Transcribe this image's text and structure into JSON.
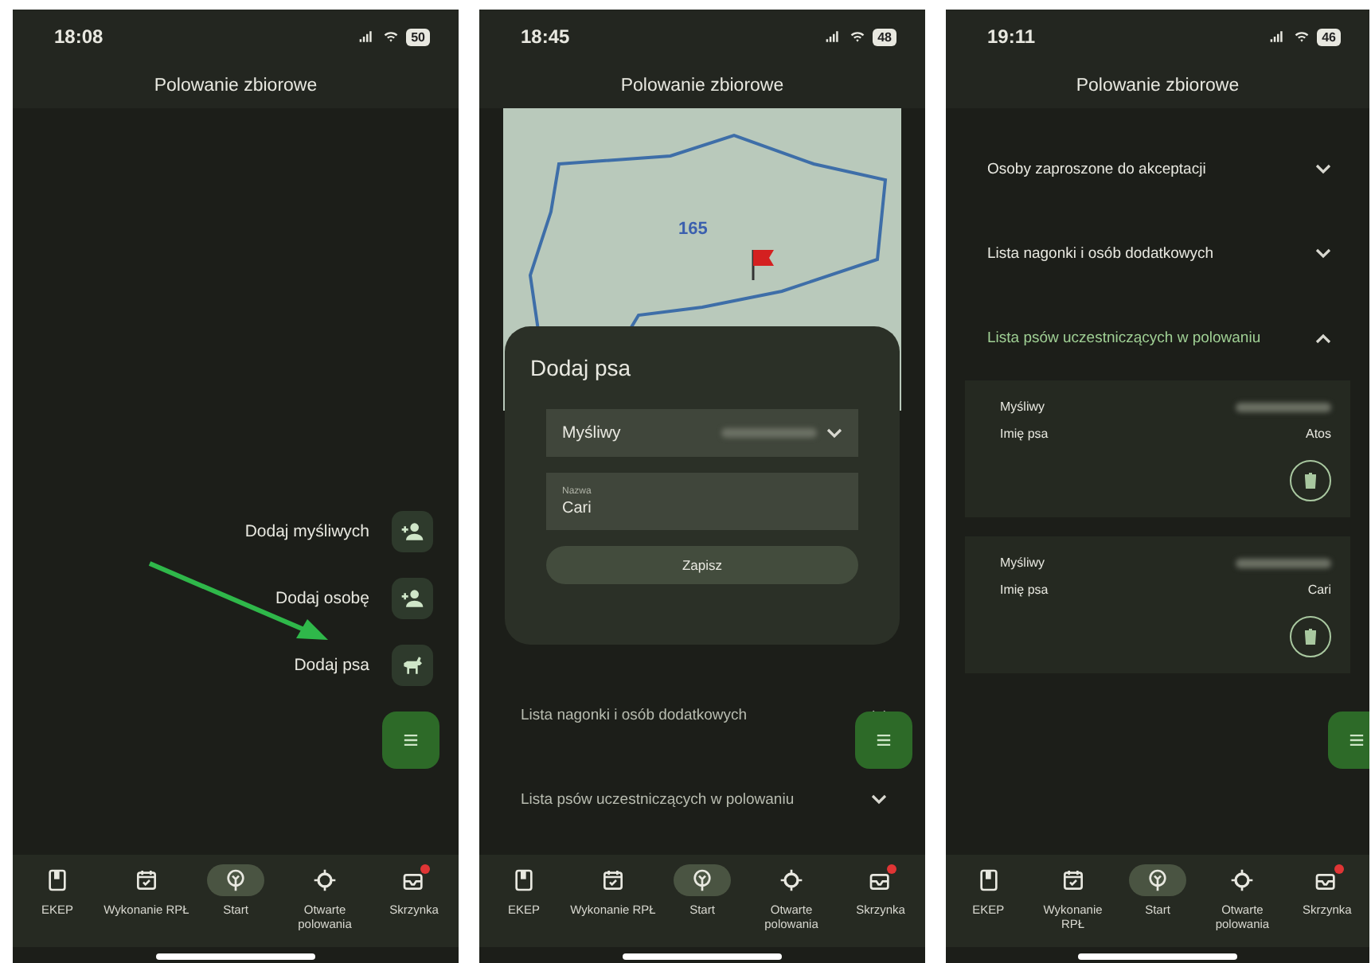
{
  "screens": [
    {
      "kind": "fab-menu",
      "time": "18:08",
      "battery": "50",
      "title": "Polowanie zbiorowe",
      "fab_actions": [
        {
          "label": "Dodaj myśliwych"
        },
        {
          "label": "Dodaj osobę"
        },
        {
          "label": "Dodaj psa"
        }
      ],
      "nav": [
        {
          "label": "EKEP",
          "selected": false,
          "badge": false
        },
        {
          "label": "Wykonanie RPŁ",
          "selected": false,
          "badge": false
        },
        {
          "label": "Start",
          "selected": true,
          "badge": false
        },
        {
          "label": "Otwarte polowania",
          "selected": false,
          "badge": false
        },
        {
          "label": "Skrzynka",
          "selected": false,
          "badge": true
        }
      ]
    },
    {
      "kind": "dialog",
      "time": "18:45",
      "battery": "48",
      "title": "Polowanie zbiorowe",
      "map": {
        "label": "165"
      },
      "dialog": {
        "title": "Dodaj psa",
        "select_label": "Myśliwy",
        "field_label": "Nazwa",
        "field_value": "Cari",
        "button": "Zapisz"
      },
      "sections": [
        {
          "title": "Lista nagonki i osób dodatkowych",
          "expanded": false
        },
        {
          "title": "Lista psów uczestniczących w polowaniu",
          "expanded": false
        }
      ],
      "nav": [
        {
          "label": "EKEP",
          "selected": false,
          "badge": false
        },
        {
          "label": "Wykonanie RPŁ",
          "selected": false,
          "badge": false
        },
        {
          "label": "Start",
          "selected": true,
          "badge": false
        },
        {
          "label": "Otwarte polowania",
          "selected": false,
          "badge": false
        },
        {
          "label": "Skrzynka",
          "selected": false,
          "badge": true
        }
      ]
    },
    {
      "kind": "list",
      "time": "19:11",
      "battery": "46",
      "title": "Polowanie zbiorowe",
      "sections": [
        {
          "title": "Osoby zaproszone do akceptacji",
          "expanded": false
        },
        {
          "title": "Lista nagonki i osób dodatkowych",
          "expanded": false
        },
        {
          "title": "Lista psów uczestniczących w polowaniu",
          "expanded": true
        }
      ],
      "dogs": [
        {
          "hunter_label": "Myśliwy",
          "name_label": "Imię psa",
          "name": "Atos"
        },
        {
          "hunter_label": "Myśliwy",
          "name_label": "Imię psa",
          "name": "Cari"
        }
      ],
      "nav": [
        {
          "label": "EKEP",
          "selected": false,
          "badge": false
        },
        {
          "label": "Wykonanie RPŁ",
          "selected": false,
          "badge": false
        },
        {
          "label": "Start",
          "selected": true,
          "badge": false
        },
        {
          "label": "Otwarte polowania",
          "selected": false,
          "badge": false
        },
        {
          "label": "Skrzynka",
          "selected": false,
          "badge": true
        }
      ]
    }
  ]
}
